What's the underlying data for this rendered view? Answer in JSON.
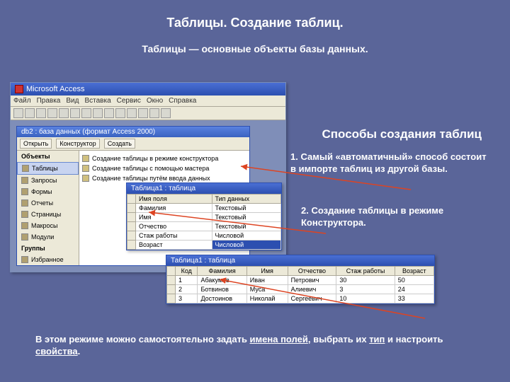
{
  "title": "Таблицы. Создание таблиц.",
  "subtitle": "Таблицы — основные объекты базы данных.",
  "rightHeading": "Способы создания таблиц",
  "method1": "1. Самый «автоматичный» способ состоит в импорте таблиц из другой базы.",
  "method2": "2. Создание таблицы в режиме Конструктора.",
  "footer_pre": "В этом режиме можно самостоятельно задать ",
  "footer_u1": "имена полей",
  "footer_mid1": ", выбрать их ",
  "footer_u2": "тип",
  "footer_mid2": " и настроить ",
  "footer_u3": "свойства",
  "footer_end": ".",
  "app": {
    "title": "Microsoft Access",
    "menu": [
      "Файл",
      "Правка",
      "Вид",
      "Вставка",
      "Сервис",
      "Окно",
      "Справка"
    ]
  },
  "dbwin": {
    "title": "db2 : база данных (формат Access 2000)",
    "toolbar": [
      "Открыть",
      "Конструктор",
      "Создать"
    ],
    "objects_label": "Объекты",
    "objects": [
      "Таблицы",
      "Запросы",
      "Формы",
      "Отчеты",
      "Страницы",
      "Макросы",
      "Модули"
    ],
    "groups_label": "Группы",
    "groups": [
      "Избранное"
    ],
    "create": [
      "Создание таблицы в режиме конструктора",
      "Создание таблицы с помощью мастера",
      "Создание таблицы путём ввода данных"
    ]
  },
  "designWin": {
    "title": "Таблица1 : таблица",
    "headers": [
      "Имя поля",
      "Тип данных"
    ],
    "rows": [
      [
        "Фамилия",
        "Текстовый"
      ],
      [
        "Имя",
        "Текстовый"
      ],
      [
        "Отчество",
        "Текстовый"
      ],
      [
        "Стаж работы",
        "Числовой"
      ],
      [
        "Возраст",
        "Числовой"
      ]
    ],
    "selected_row": 4
  },
  "dataWin": {
    "title": "Таблица1 : таблица",
    "headers": [
      "Код",
      "Фамилия",
      "Имя",
      "Отчество",
      "Стаж работы",
      "Возраст"
    ],
    "rows": [
      [
        "1",
        "Абакумов",
        "Иван",
        "Петрович",
        "30",
        "50"
      ],
      [
        "2",
        "Ботвинов",
        "Муса",
        "Алиевич",
        "3",
        "24"
      ],
      [
        "3",
        "Достоинов",
        "Николай",
        "Сергеевич",
        "10",
        "33"
      ]
    ]
  }
}
